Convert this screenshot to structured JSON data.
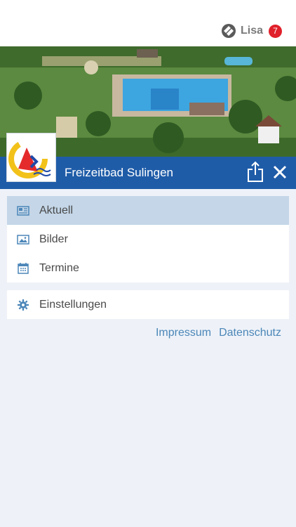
{
  "header": {
    "user_name": "Lisa",
    "notification_count": "7"
  },
  "venue": {
    "title": "Freizeitbad Sulingen"
  },
  "menu": {
    "items": [
      {
        "label": "Aktuell",
        "icon": "newspaper-icon",
        "active": true
      },
      {
        "label": "Bilder",
        "icon": "image-icon",
        "active": false
      },
      {
        "label": "Termine",
        "icon": "calendar-icon",
        "active": false
      }
    ],
    "settings_label": "Einstellungen"
  },
  "footer_links": {
    "impressum": "Impressum",
    "datenschutz": "Datenschutz"
  },
  "colors": {
    "accent_blue": "#1f5ca8",
    "active_item": "#c4d6e8",
    "badge_red": "#e0202a",
    "link_blue": "#4b86b8",
    "background": "#eef2f8"
  }
}
